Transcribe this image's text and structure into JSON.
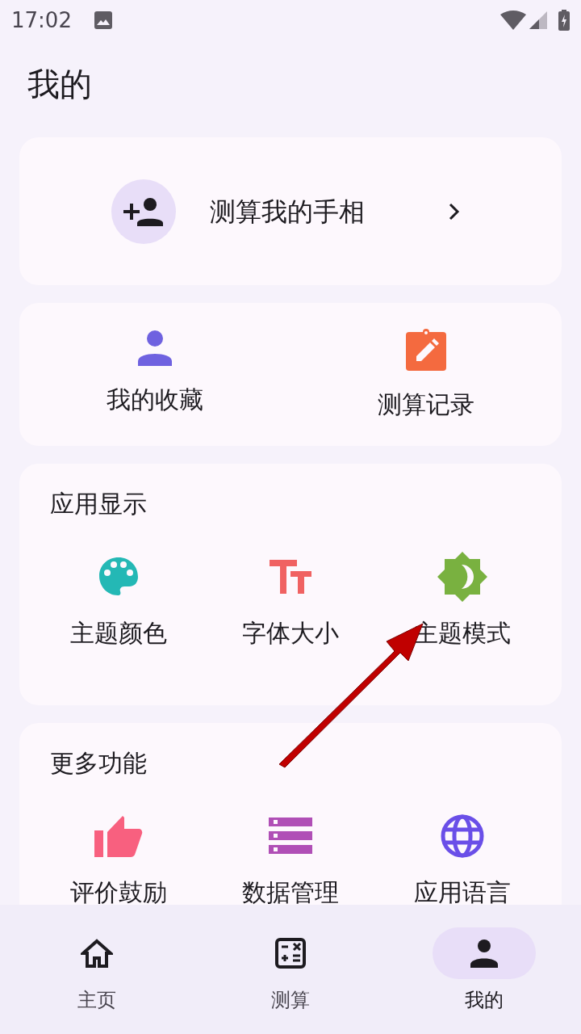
{
  "status_bar": {
    "time": "17:02"
  },
  "page_title": "我的",
  "profile_card": {
    "label": "测算我的手相"
  },
  "quick_links": [
    {
      "label": "我的收藏"
    },
    {
      "label": "测算记录"
    }
  ],
  "sections": [
    {
      "title": "应用显示",
      "items": [
        {
          "label": "主题颜色"
        },
        {
          "label": "字体大小"
        },
        {
          "label": "主题模式"
        }
      ]
    },
    {
      "title": "更多功能",
      "items": [
        {
          "label": "评价鼓励"
        },
        {
          "label": "数据管理"
        },
        {
          "label": "应用语言"
        }
      ]
    }
  ],
  "bottom_nav": [
    {
      "label": "主页",
      "selected": false
    },
    {
      "label": "测算",
      "selected": false
    },
    {
      "label": "我的",
      "selected": true
    }
  ]
}
